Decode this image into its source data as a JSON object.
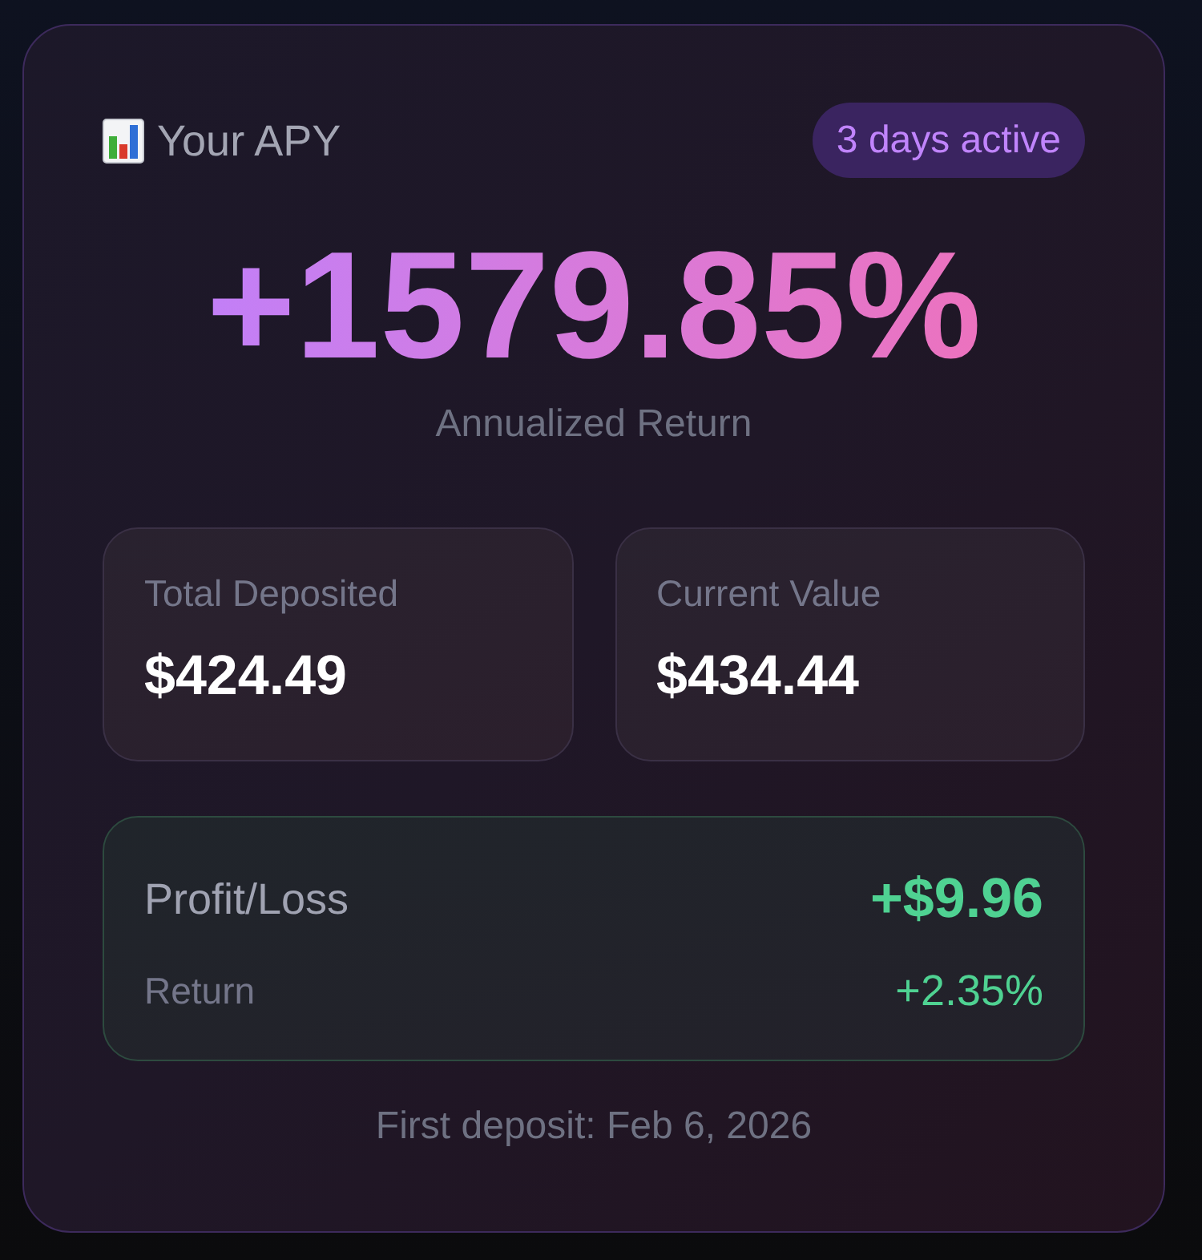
{
  "header": {
    "title": "Your APY",
    "badge": "3 days active"
  },
  "apy": {
    "value": "+1579.85%",
    "caption": "Annualized Return"
  },
  "stats": [
    {
      "label": "Total Deposited",
      "value": "$424.49"
    },
    {
      "label": "Current Value",
      "value": "$434.44"
    }
  ],
  "profit_loss": {
    "label": "Profit/Loss",
    "value": "+$9.96",
    "return_label": "Return",
    "return_value": "+2.35%"
  },
  "footer": "First deposit: Feb 6, 2026"
}
